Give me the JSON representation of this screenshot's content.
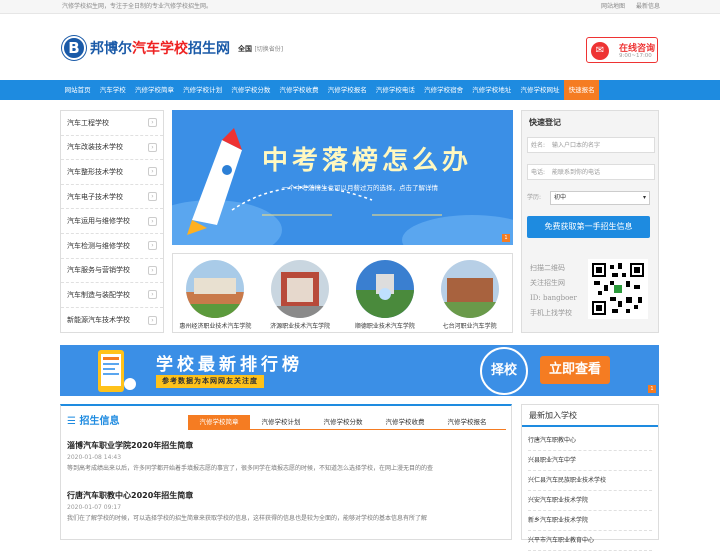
{
  "topbar": {
    "slogan": "汽修学校招生网，专注于全日制的专业汽修学校招生网。",
    "links": [
      "网站地图",
      "最新信息"
    ]
  },
  "header": {
    "logo_b": "B",
    "logo_part1": "邦博尔",
    "logo_part2": "汽车学校",
    "logo_part3": "招生网",
    "region": "全国",
    "region_switch": "[切换省份]",
    "consult_title": "在线咨询",
    "consult_hours": "9:00~17:00"
  },
  "nav": {
    "items": [
      "网站首页",
      "汽车学校",
      "汽修学校简章",
      "汽修学校计划",
      "汽修学校分数",
      "汽修学校收费",
      "汽修学校报名",
      "汽修学校电话",
      "汽修学校宿舍",
      "汽修学校地址",
      "汽修学校网址"
    ],
    "highlight": "快速报名"
  },
  "sidebar": {
    "items": [
      "汽车工程学校",
      "汽车改装技术学校",
      "汽车整形技术学校",
      "汽车电子技术学校",
      "汽车运用与维修学校",
      "汽车检测与维修学校",
      "汽车服务与营销学校",
      "汽车制造与装配学校",
      "新能源汽车技术学校"
    ]
  },
  "banner": {
    "title": "中考落榜怎么办",
    "subtitle": "一个中考落榜生也可以月薪过万的选择，点击了解详情",
    "index": "1"
  },
  "schools": [
    "惠州经济职业技术汽车学院",
    "济源职业技术汽车学院",
    "顺德职业技术汽车学院",
    "七台河职业汽车学院"
  ],
  "login": {
    "title": "快速登记",
    "name_label": "姓名:",
    "name_placeholder": "输入户口本的名字",
    "phone_label": "电话:",
    "phone_placeholder": "能联系到你的电话",
    "edu_label": "学历:",
    "edu_value": "初中",
    "submit": "免费获取第一手招生信息",
    "qr_lines": [
      "扫描二维码",
      "关注招生网",
      "ID: bangboer",
      "手机上找学校"
    ]
  },
  "wide_banner": {
    "title": "学校最新排行榜",
    "subtitle": "参考数据为本网网友关注度",
    "choose": "择校",
    "check": "立即查看",
    "index": "1"
  },
  "news": {
    "title": "招生信息",
    "tabs": [
      "汽修学校简章",
      "汽修学校计划",
      "汽修学校分数",
      "汽修学校收费",
      "汽修学校报名"
    ],
    "articles": [
      {
        "title": "淄博汽车职业学院2020年招生简章",
        "date": "2020-01-08 14:43",
        "excerpt": "等到高考成绩出来以后，许多同学都开始着手填报志愿的事宜了，很多同学在填报志愿的时候，不知道怎么选择学校，在网上漫无目的的查"
      },
      {
        "title": "行唐汽车职教中心2020年招生简章",
        "date": "2020-01-07 09:17",
        "excerpt": "我们在了解学校的时候，可以选择学校的招生简章来获取学校的信息，这样获得的信息也是较为全面的，能够对学校的基本信息有所了解"
      }
    ]
  },
  "latest": {
    "title": "最新加入学校",
    "items": [
      "行唐汽车职教中心",
      "兴县职业汽车中学",
      "兴仁县汽车民族职业技术学校",
      "兴安汽车职业技术学院",
      "新乡汽车职业技术学院",
      "兴平市汽车职业教育中心"
    ]
  }
}
